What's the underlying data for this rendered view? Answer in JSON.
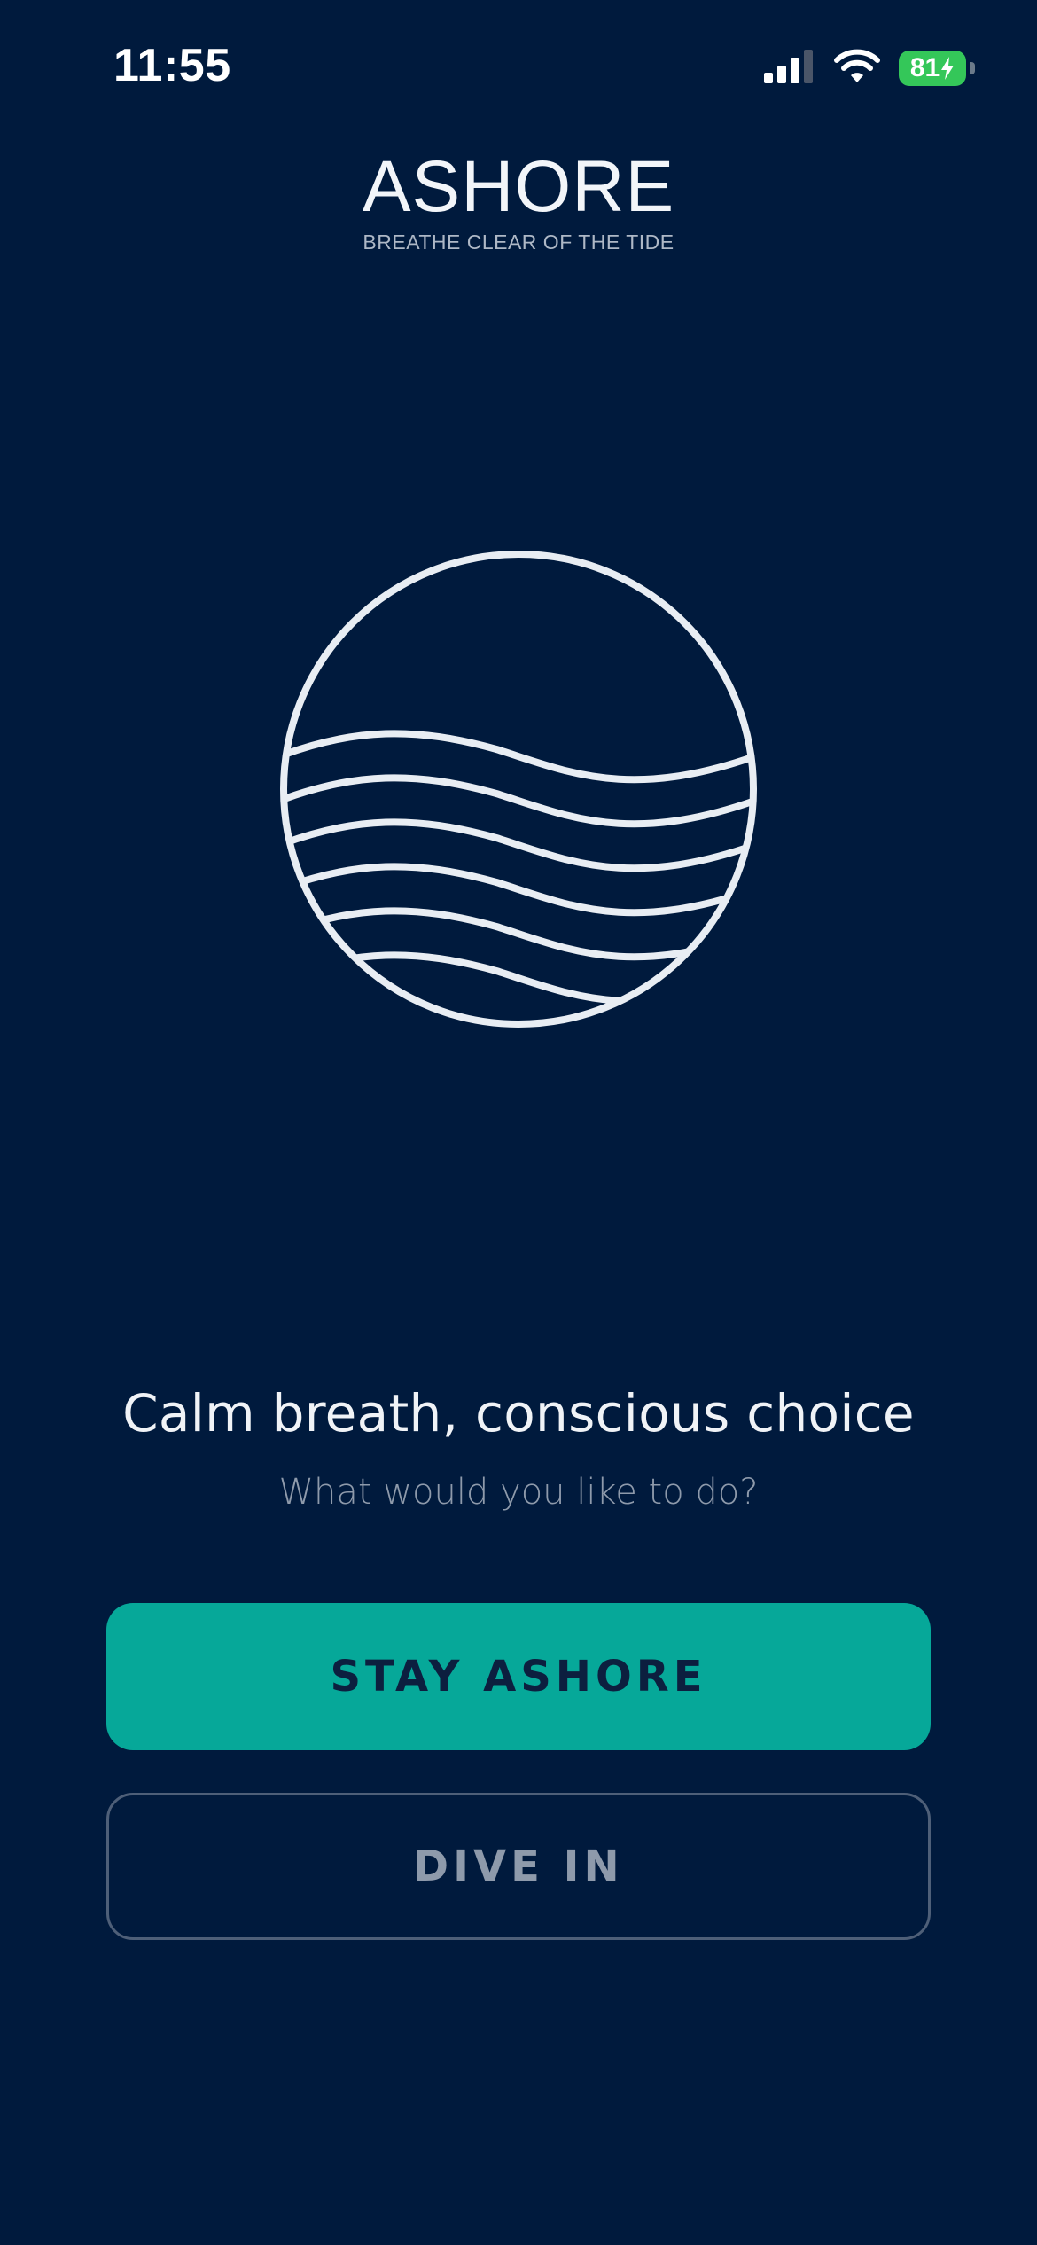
{
  "status_bar": {
    "time": "11:55",
    "battery_level": "81",
    "icons": [
      "cellular-signal-icon",
      "wifi-icon",
      "battery-charging-icon"
    ],
    "battery_color": "#34c759"
  },
  "brand": {
    "title": "ASHORE",
    "tagline": "BREATHE CLEAR OF THE TIDE",
    "logo_icon": "waves-circle-icon"
  },
  "prompt": {
    "title": "Calm breath, conscious choice",
    "subtitle": "What would you like to do?"
  },
  "actions": {
    "primary_label": "STAY ASHORE",
    "secondary_label": "DIVE IN"
  },
  "colors": {
    "background": "#001a3d",
    "accent": "#06a899",
    "text_primary": "#f0f3f7",
    "text_muted": "#8e9aab"
  }
}
